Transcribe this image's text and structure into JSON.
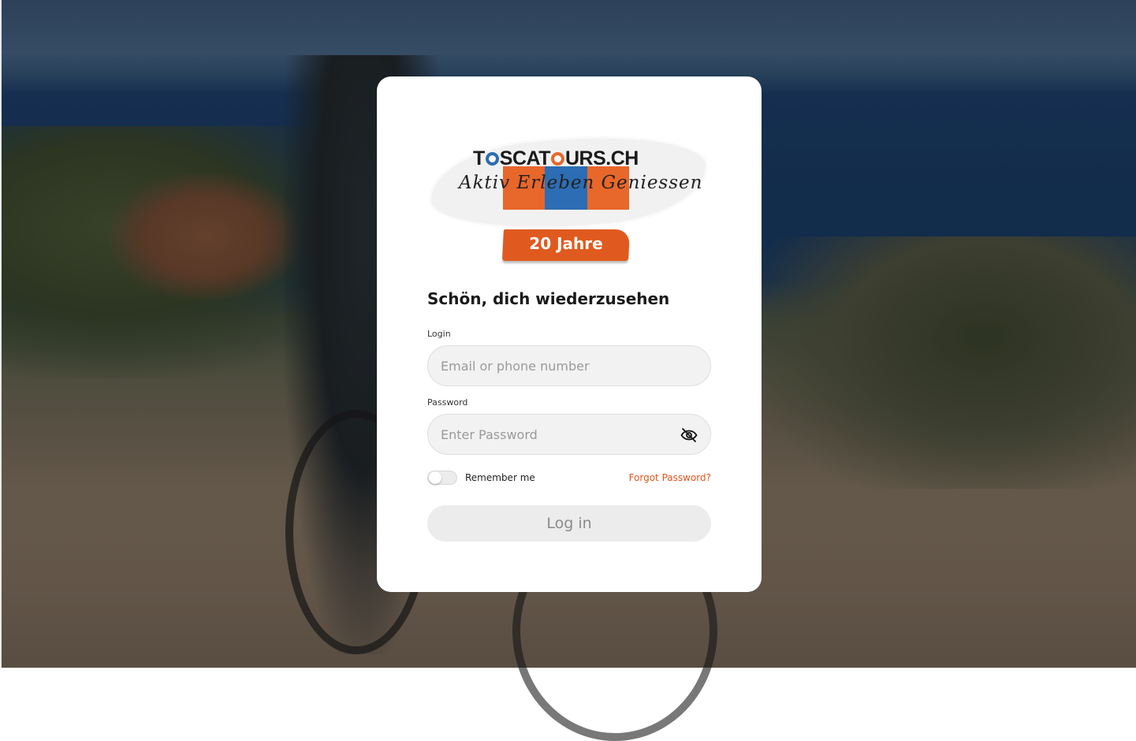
{
  "brand": {
    "name_prefix": "T",
    "name_mid": "SCAT",
    "name_suffix": "URS.CH",
    "tagline": "Aktiv Erleben Geniessen",
    "anniversary": "20 Jahre"
  },
  "form": {
    "heading": "Schön, dich wiederzusehen",
    "login_label": "Login",
    "login_placeholder": "Email or phone number",
    "login_value": "",
    "password_label": "Password",
    "password_placeholder": "Enter Password",
    "password_value": "",
    "remember_label": "Remember me",
    "remember_checked": false,
    "forgot_label": "Forgot Password?",
    "submit_label": "Log in"
  },
  "icons": {
    "password_toggle": "eye-off-icon"
  },
  "colors": {
    "accent": "#e2561c",
    "brand_orange": "#e8672b",
    "brand_blue": "#2d6db3"
  }
}
